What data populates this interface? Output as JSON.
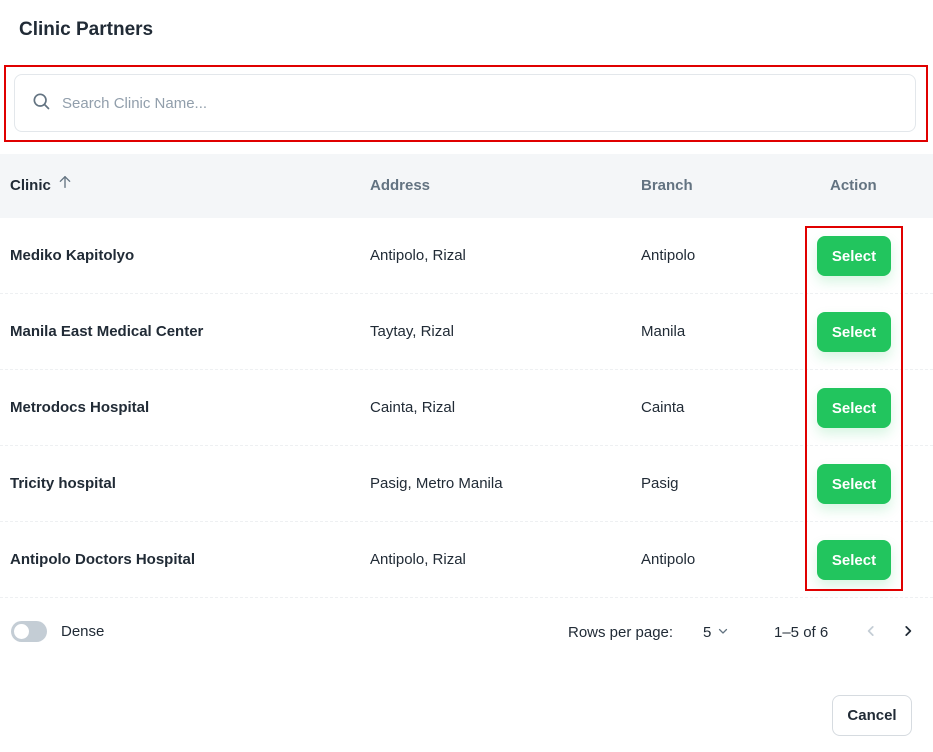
{
  "dialog": {
    "title": "Clinic Partners"
  },
  "search": {
    "placeholder": "Search Clinic Name...",
    "value": "",
    "icon": "search-icon"
  },
  "table": {
    "headers": {
      "clinic": "Clinic",
      "address": "Address",
      "branch": "Branch",
      "action": "Action"
    },
    "sort_icon": "arrow-up-icon",
    "rows": [
      {
        "clinic": "Mediko Kapitolyo",
        "address": "Antipolo, Rizal",
        "branch": "Antipolo",
        "action": "Select"
      },
      {
        "clinic": "Manila East Medical Center",
        "address": "Taytay, Rizal",
        "branch": "Manila",
        "action": "Select"
      },
      {
        "clinic": "Metrodocs Hospital",
        "address": "Cainta, Rizal",
        "branch": "Cainta",
        "action": "Select"
      },
      {
        "clinic": "Tricity hospital",
        "address": "Pasig, Metro Manila",
        "branch": "Pasig",
        "action": "Select"
      },
      {
        "clinic": "Antipolo Doctors Hospital",
        "address": "Antipolo, Rizal",
        "branch": "Antipolo",
        "action": "Select"
      }
    ]
  },
  "footer": {
    "dense_label": "Dense",
    "dense_enabled": false,
    "rows_per_page_label": "Rows per page:",
    "rows_per_page_value": "5",
    "range_text": "1–5 of 6"
  },
  "actions": {
    "cancel_label": "Cancel"
  },
  "colors": {
    "accent": "#22C55E",
    "highlight": "#e00000",
    "header_bg": "#F4F6F8"
  }
}
